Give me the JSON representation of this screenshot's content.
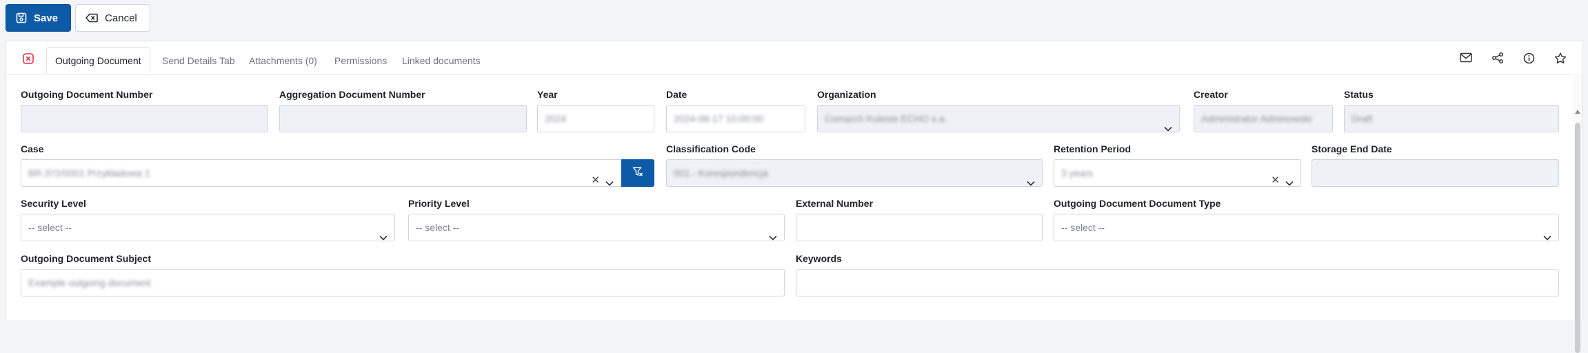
{
  "toolbar": {
    "save_label": "Save",
    "cancel_label": "Cancel"
  },
  "tabs": [
    {
      "label": "Outgoing Document"
    },
    {
      "label": "Send Details Tab"
    },
    {
      "label": "Attachments (0)"
    },
    {
      "label": "Permissions"
    },
    {
      "label": "Linked documents"
    }
  ],
  "tab_icons": [
    "mail-icon",
    "share-icon",
    "info-icon",
    "star-icon"
  ],
  "form": {
    "outgoing_number": {
      "label": "Outgoing Document Number",
      "value": ""
    },
    "aggregation_number": {
      "label": "Aggregation Document Number",
      "value": ""
    },
    "year": {
      "label": "Year",
      "value": "2024"
    },
    "date": {
      "label": "Date",
      "value": "2024-08-17 10:00:00"
    },
    "organization": {
      "label": "Organization",
      "value": "Comarch Kolesie ECHO s.a."
    },
    "creator": {
      "label": "Creator",
      "value": "Administrator Adminowski"
    },
    "status": {
      "label": "Status",
      "value": "Draft"
    },
    "case": {
      "label": "Case",
      "value": "BR.372/0001 Przykładowa 1"
    },
    "classification": {
      "label": "Classification Code",
      "value": "001 - Korespondencja"
    },
    "retention": {
      "label": "Retention Period",
      "value": "3 years"
    },
    "storage_end": {
      "label": "Storage End Date",
      "value": ""
    },
    "security_level": {
      "label": "Security Level",
      "placeholder": "-- select --"
    },
    "priority_level": {
      "label": "Priority Level",
      "placeholder": "-- select --"
    },
    "external_number": {
      "label": "External Number",
      "value": ""
    },
    "doc_type": {
      "label": "Outgoing Document Document Type",
      "placeholder": "-- select --"
    },
    "subject": {
      "label": "Outgoing Document Subject",
      "value": "Example outgoing document"
    },
    "keywords": {
      "label": "Keywords",
      "value": ""
    }
  },
  "colors": {
    "primary": "#0d5aa7",
    "danger": "#dc3545",
    "readonly_bg": "#eef1f5"
  }
}
